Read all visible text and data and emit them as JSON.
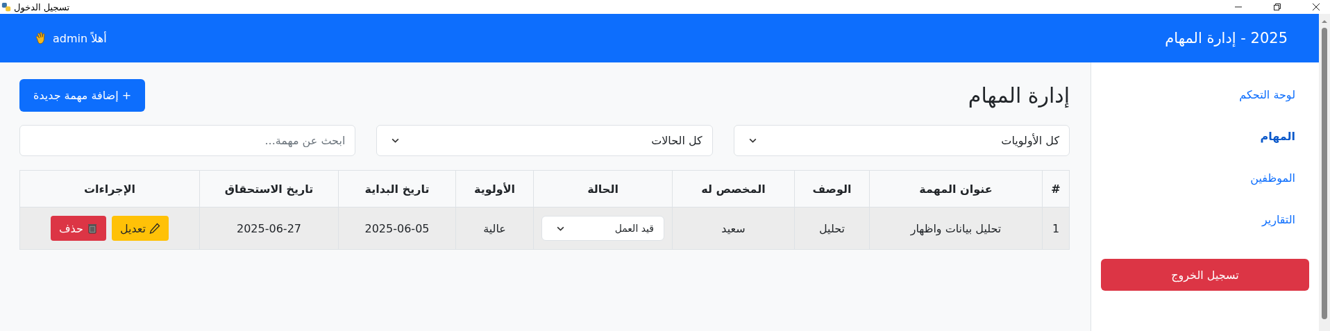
{
  "window": {
    "title": "تسجيل الدخول"
  },
  "navbar": {
    "brand": "2025 - إدارة المهام",
    "greeting": "أهلاً admin"
  },
  "sidebar": {
    "items": [
      {
        "label": "لوحة التحكم",
        "selected": false
      },
      {
        "label": "المهام",
        "selected": true
      },
      {
        "label": "الموظفين",
        "selected": false
      },
      {
        "label": "التقارير",
        "selected": false
      }
    ],
    "logout": "تسجيل الخروج"
  },
  "page": {
    "heading": "إدارة المهام",
    "add_button": "+ إضافة مهمة جديدة"
  },
  "filters": {
    "priority": "كل الأولويات",
    "status": "كل الحالات",
    "search": {
      "placeholder": "ابحث عن مهمة..."
    }
  },
  "table": {
    "columns": [
      "#",
      "عنوان المهمة",
      "الوصف",
      "المخصص له",
      "الحالة",
      "الأولوية",
      "تاريخ البداية",
      "تاريخ الاستحقاق",
      "الإجراءات"
    ],
    "rows": [
      {
        "number": "1",
        "title": "تحليل بيانات واظهار",
        "description": "تحليل",
        "assignee": "سعيد",
        "status": "قيد العمل",
        "priority": "عالية",
        "start": "2025-06-05",
        "due": "2025-06-27",
        "edit": "تعديل",
        "delete": "حذف"
      }
    ]
  }
}
